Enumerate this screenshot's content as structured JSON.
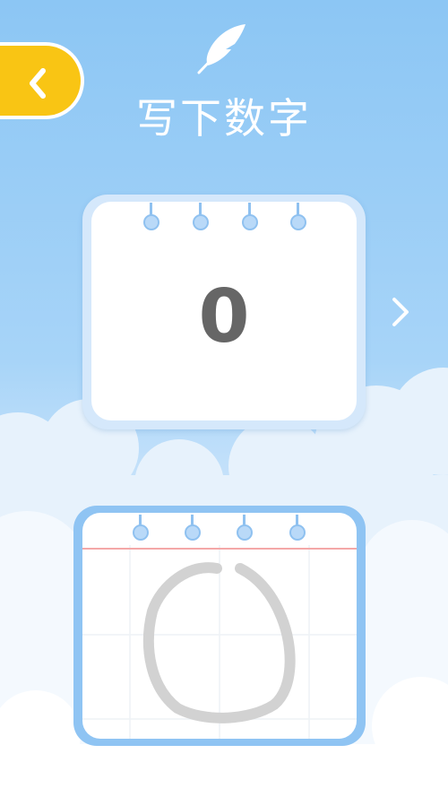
{
  "header": {
    "title": "写下数字",
    "back_icon": "chevron-left-icon",
    "feather_icon": "feather-icon"
  },
  "sample_card": {
    "digit": "0",
    "next_icon": "chevron-right-icon"
  },
  "colors": {
    "sky_top": "#8cc6f4",
    "back_button": "#f9c514",
    "ring": "#8fc1f0",
    "digit": "#666666",
    "stroke": "#d2d2d2",
    "margin_line": "#f4a8a8"
  }
}
